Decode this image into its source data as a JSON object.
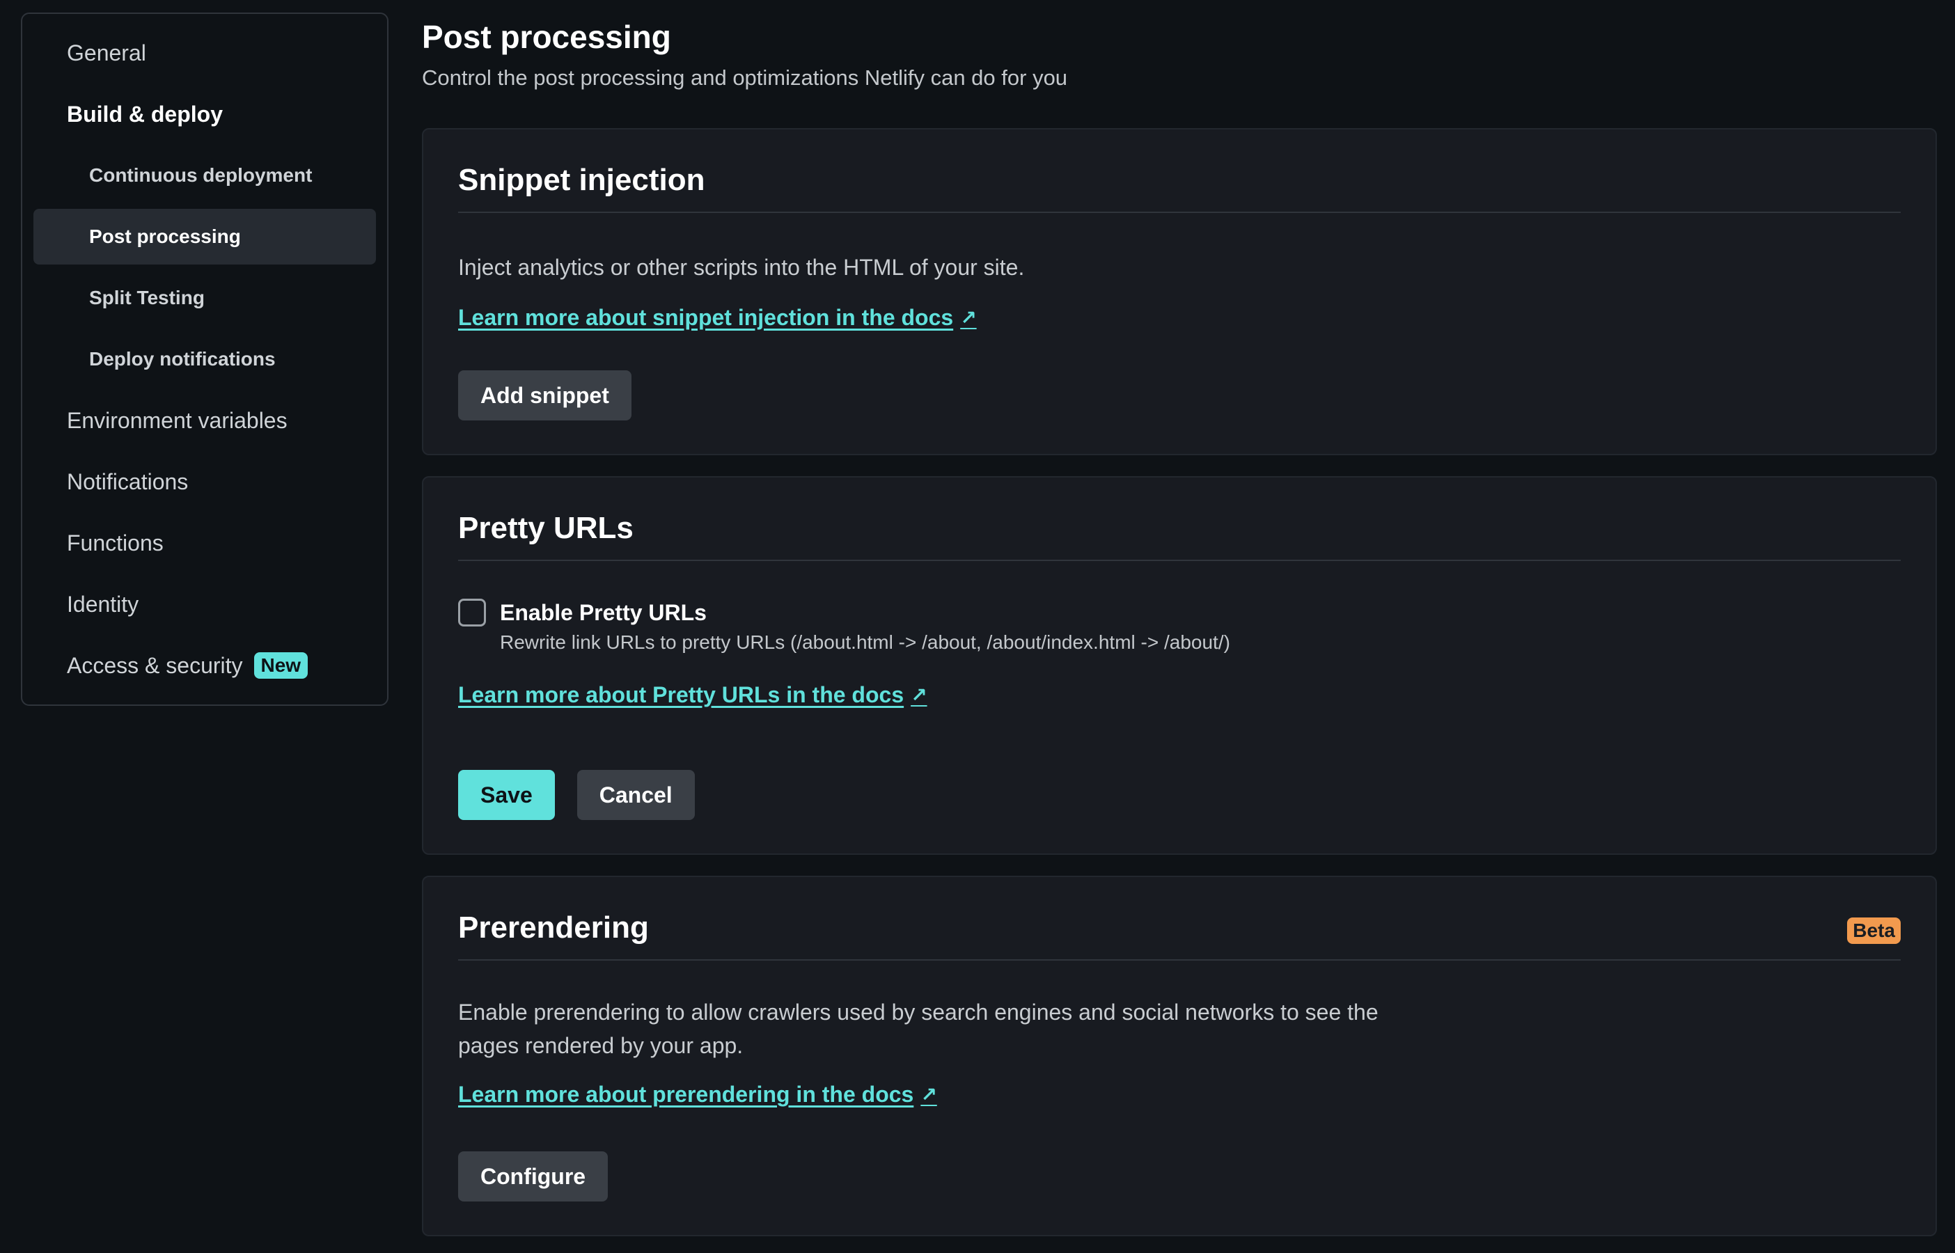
{
  "sidebar": {
    "items": [
      {
        "label": "General"
      },
      {
        "label": "Build & deploy"
      },
      {
        "label": "Continuous deployment"
      },
      {
        "label": "Post processing"
      },
      {
        "label": "Split Testing"
      },
      {
        "label": "Deploy notifications"
      },
      {
        "label": "Environment variables"
      },
      {
        "label": "Notifications"
      },
      {
        "label": "Functions"
      },
      {
        "label": "Identity"
      },
      {
        "label": "Access & security",
        "badge": "New"
      }
    ]
  },
  "header": {
    "title": "Post processing",
    "subtitle": "Control the post processing and optimizations Netlify can do for you"
  },
  "snippet": {
    "title": "Snippet injection",
    "description": "Inject analytics or other scripts into the HTML of your site.",
    "link": "Learn more about snippet injection in the docs",
    "button": "Add snippet"
  },
  "pretty_urls": {
    "title": "Pretty URLs",
    "checkbox_label": "Enable Pretty URLs",
    "checkbox_checked": false,
    "checkbox_description": "Rewrite link URLs to pretty URLs (/about.html -> /about, /about/index.html -> /about/)",
    "link": "Learn more about Pretty URLs in the docs",
    "save": "Save",
    "cancel": "Cancel"
  },
  "prerendering": {
    "title": "Prerendering",
    "badge": "Beta",
    "description_line1": "Enable prerendering to allow crawlers used by search engines and social networks to see the",
    "description_line2": "pages rendered by your app.",
    "link": "Learn more about prerendering in the docs",
    "button": "Configure"
  },
  "colors": {
    "accent": "#60e1dc",
    "beta": "#f29a4e",
    "background": "#0e1216",
    "card": "#181b21"
  },
  "icons": {
    "external_link": "arrow-up-right-icon"
  }
}
